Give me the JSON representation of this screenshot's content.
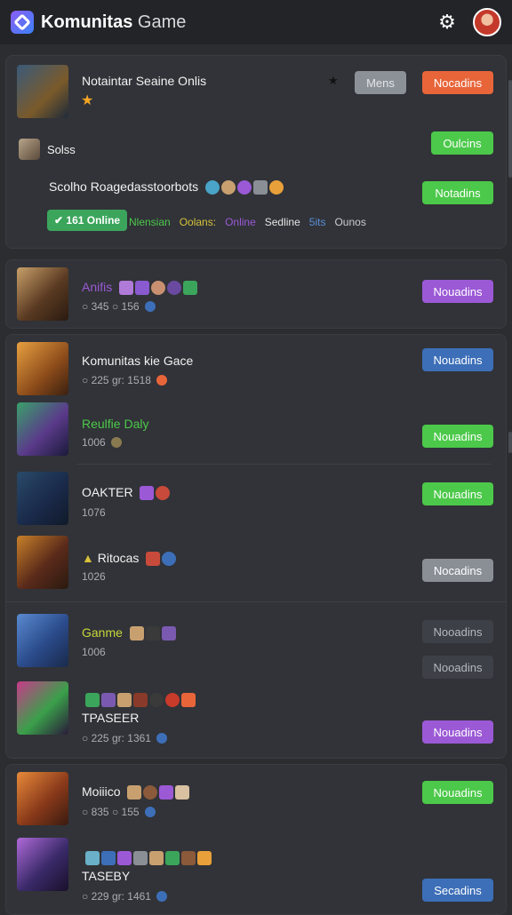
{
  "header": {
    "title_bold": "Komunitas",
    "title_rest": " Game"
  },
  "top_card": {
    "title": "Notaintar Seaine Onlis",
    "star": "★",
    "menu_btn": "Mens",
    "orange_btn": "Nocadins",
    "user_label": "Solss",
    "green_btn1": "Oulcins",
    "subtitle": "Scolho Roagedasstoorbots",
    "green_btn2": "Notadins",
    "online_badge": "✔ 161 Online",
    "tags": [
      {
        "text": "Nlensian",
        "color": "#4cc94a"
      },
      {
        "text": "Oolans:",
        "color": "#d6c13a"
      },
      {
        "text": "Online",
        "color": "#9b59d6"
      },
      {
        "text": "Sedline",
        "color": "#e6e6e6"
      },
      {
        "text": "5its",
        "color": "#5a8fd8"
      },
      {
        "text": "Ounos",
        "color": "#c9cdd2"
      }
    ]
  },
  "rows": [
    {
      "title": "Anifis",
      "title_color": "#9b59d6",
      "meta": "○ 345  ○ 156",
      "btn": "Nouadins"
    },
    {
      "title": "Komunitas kie Gace",
      "title_color": "#f2f2f2",
      "meta": "○ 225 gr: 1518",
      "btn": "Nouadins"
    },
    {
      "title": "Reulfie Daly",
      "title_color": "#4cc94a",
      "meta": "1006",
      "btn": "Nouadins"
    },
    {
      "title": "OAKTER",
      "title_color": "#f2f2f2",
      "meta": "1076",
      "btn": "Nouadins"
    },
    {
      "title": "Ritocas",
      "title_color": "#f2f2f2",
      "meta": "1026",
      "btn": "Nocadins"
    },
    {
      "title": "Ganme",
      "title_color": "#c9d63a",
      "meta": "1006",
      "btn": "Nooadins",
      "btn2": "Nooadins"
    },
    {
      "title": "TPASEER",
      "title_color": "#f2f2f2",
      "meta": "○ 225 gr: 1361",
      "btn": "Nouadins"
    },
    {
      "title": "Moiiico",
      "title_color": "#f2f2f2",
      "meta": "○ 835  ○ 155",
      "btn": "Nouadins"
    },
    {
      "title": "TASEBY",
      "title_color": "#f2f2f2",
      "meta": "○ 229 gr: 1461",
      "btn": "Secadins"
    }
  ]
}
